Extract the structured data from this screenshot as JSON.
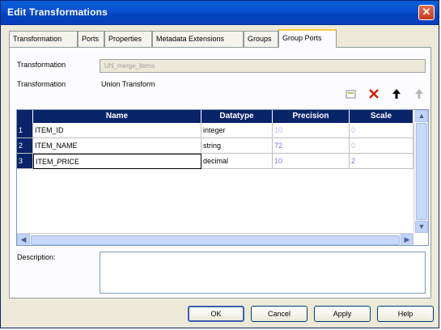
{
  "window": {
    "title": "Edit Transformations",
    "close_label": "✕"
  },
  "tabs": [
    {
      "label": "Transformation"
    },
    {
      "label": "Ports"
    },
    {
      "label": "Properties"
    },
    {
      "label": "Metadata Extensions"
    },
    {
      "label": "Groups"
    },
    {
      "label": "Group Ports",
      "active": true
    }
  ],
  "form": {
    "transformation_label_1": "Transformation",
    "transformation_value_1": "UN_merge_items",
    "transformation_label_2": "Transformation",
    "transformation_value_2": "Union Transform",
    "description_label": "Description:"
  },
  "toolbar": {
    "new_icon": "new-port-icon",
    "delete_icon": "delete-icon",
    "move_up_icon": "move-up-icon",
    "move_down_icon": "move-down-icon"
  },
  "grid": {
    "columns": [
      "Name",
      "Datatype",
      "Precision",
      "Scale"
    ],
    "rows": [
      {
        "num": "1",
        "name": "ITEM_ID",
        "datatype": "integer",
        "precision": "10",
        "scale": "0"
      },
      {
        "num": "2",
        "name": "ITEM_NAME",
        "datatype": "string",
        "precision": "72",
        "scale": "0"
      },
      {
        "num": "3",
        "name": "ITEM_PRICE",
        "datatype": "decimal",
        "precision": "10",
        "scale": "2"
      }
    ]
  },
  "buttons": {
    "ok": "OK",
    "cancel": "Cancel",
    "apply": "Apply",
    "help": "Help"
  },
  "colors": {
    "titlebar": "#0a4fd0",
    "header": "#0a246a",
    "active_tab_accent": "#ffc83c"
  }
}
